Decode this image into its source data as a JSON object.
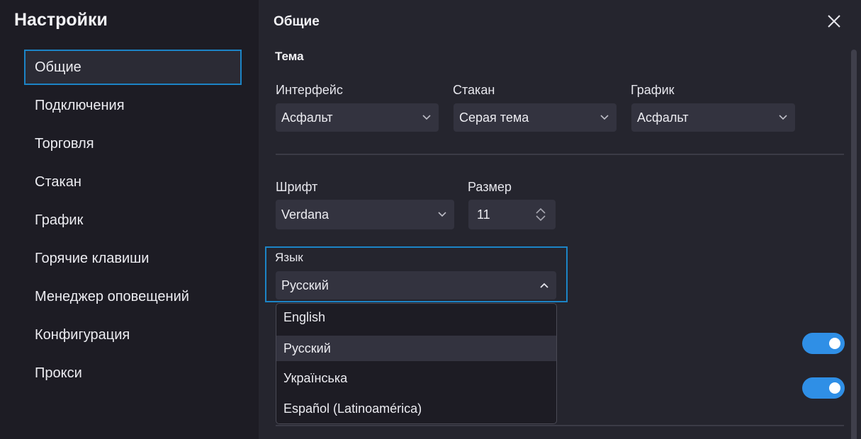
{
  "sidebar": {
    "title": "Настройки",
    "items": [
      {
        "label": "Общие"
      },
      {
        "label": "Подключения"
      },
      {
        "label": "Торговля"
      },
      {
        "label": "Стакан"
      },
      {
        "label": "График"
      },
      {
        "label": "Горячие клавиши"
      },
      {
        "label": "Менеджер оповещений"
      },
      {
        "label": "Конфигурация"
      },
      {
        "label": "Прокси"
      }
    ]
  },
  "header": {
    "title": "Общие",
    "close_icon": "close-icon"
  },
  "theme": {
    "section_title": "Тема",
    "interface": {
      "label": "Интерфейс",
      "value": "Асфальт"
    },
    "orderbook": {
      "label": "Стакан",
      "value": "Серая тема"
    },
    "chart": {
      "label": "График",
      "value": "Асфальт"
    }
  },
  "font": {
    "family": {
      "label": "Шрифт",
      "value": "Verdana"
    },
    "size": {
      "label": "Размер",
      "value": "11"
    }
  },
  "language": {
    "label": "Язык",
    "value": "Русский",
    "options": [
      "English",
      "Русский",
      "Українська",
      "Español (Latinoamérica)"
    ]
  },
  "toggles": [
    {
      "on": true
    },
    {
      "on": true
    }
  ],
  "colors": {
    "accent": "#1c84c6",
    "toggle_on": "#2f8fe6",
    "sidebar_bg": "#1d1c24",
    "main_bg": "#25252e"
  }
}
